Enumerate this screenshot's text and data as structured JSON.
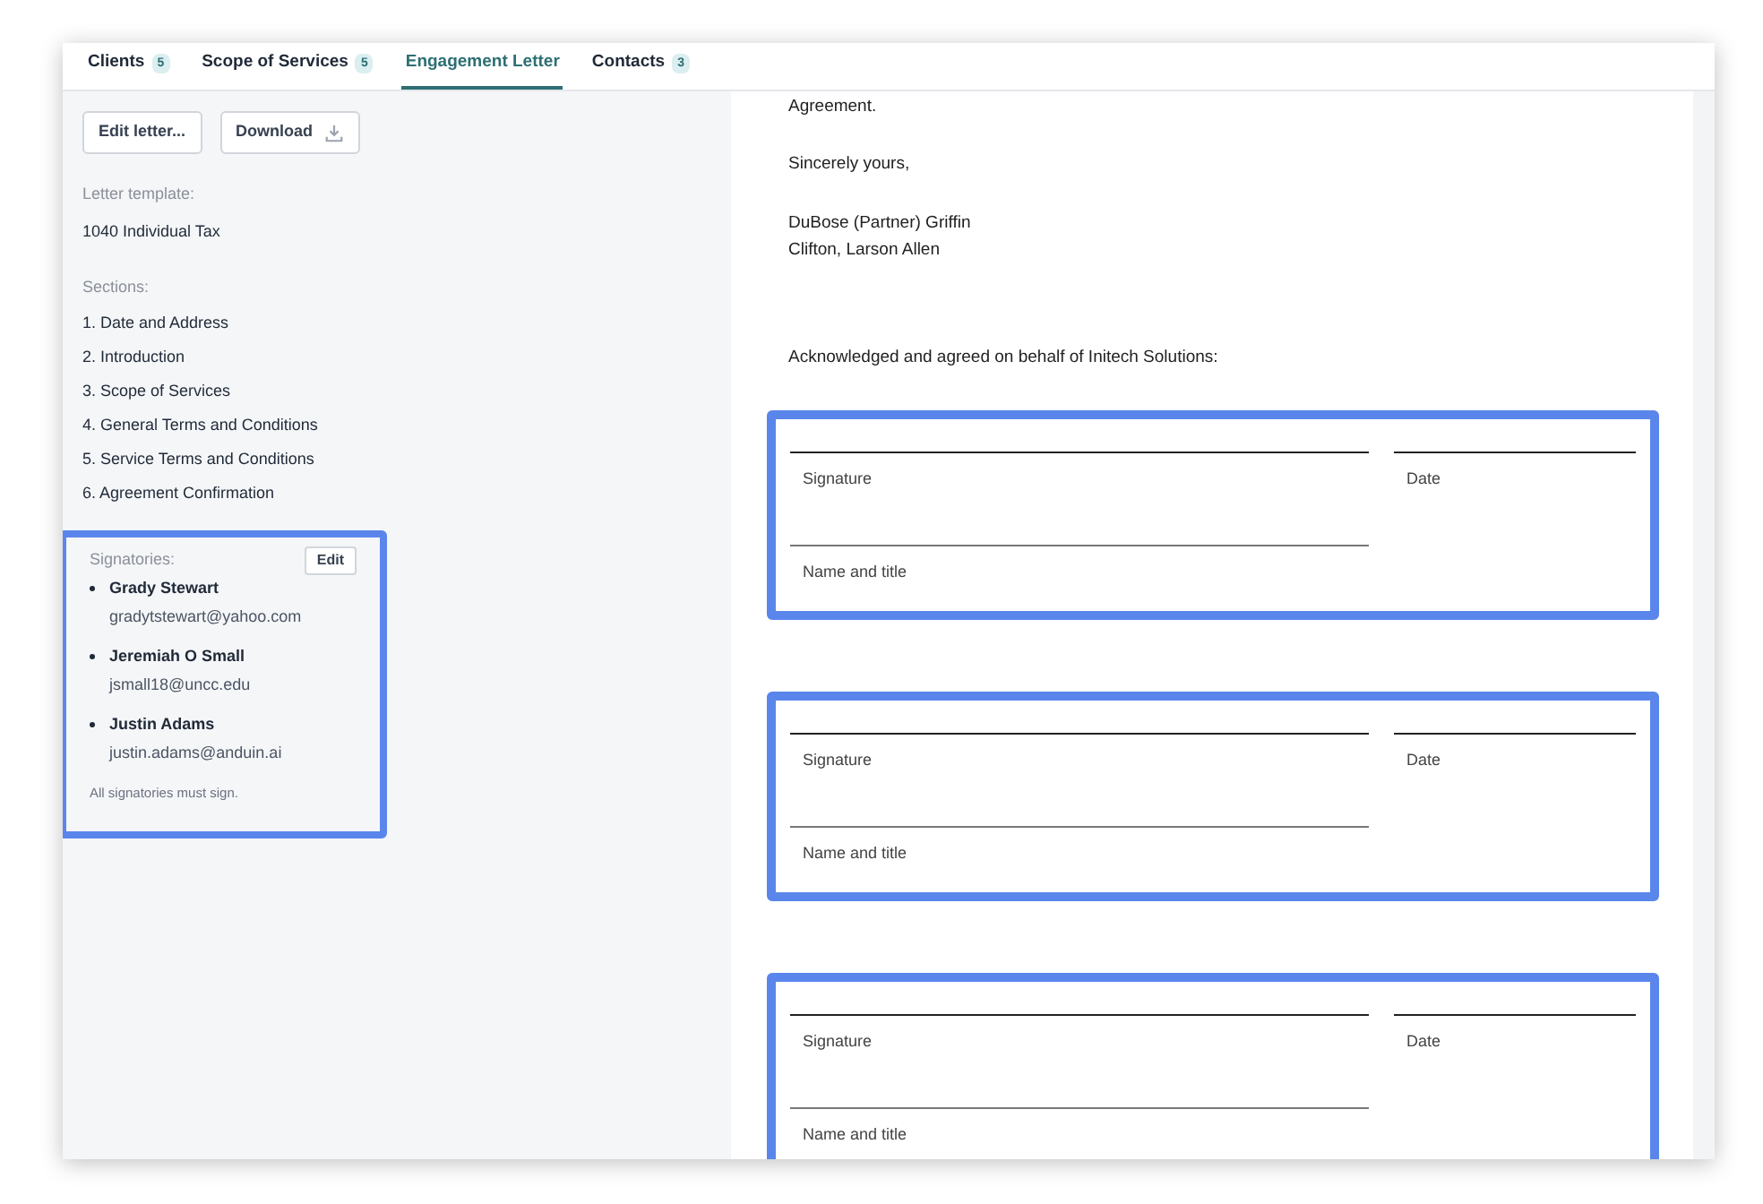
{
  "tabs": [
    {
      "label": "Clients",
      "count": "5",
      "selected": false
    },
    {
      "label": "Scope of Services",
      "count": "5",
      "selected": false
    },
    {
      "label": "Engagement Letter",
      "selected": true
    },
    {
      "label": "Contacts",
      "count": "3",
      "selected": false
    }
  ],
  "actions": [
    {
      "label": "Edit letter...",
      "kind": "plain"
    },
    {
      "label": "Download",
      "kind": "download"
    }
  ],
  "letter_template": {
    "label": "Letter template:",
    "value": "1040 Individual Tax"
  },
  "sections": {
    "label": "Sections:",
    "items": [
      "1. Date and Address",
      "2. Introduction",
      "3. Scope of Services",
      "4. General Terms and Conditions",
      "5. Service Terms and Conditions",
      "6. Agreement Confirmation"
    ]
  },
  "signatories": {
    "label": "Signatories:",
    "edit_button": "Edit",
    "highlighted": true,
    "people": [
      {
        "name": "Grady Stewart",
        "email": "gradytstewart@yahoo.com"
      },
      {
        "name": "Jeremiah O Small",
        "email": "jsmall18@uncc.edu"
      },
      {
        "name": "Justin Adams",
        "email": "justin.adams@anduin.ai"
      }
    ],
    "note": "All signatories must sign."
  },
  "document": {
    "lines": [
      "Agreement.",
      "Sincerely yours,"
    ],
    "signer": [
      "DuBose (Partner) Griffin",
      "Clifton, Larson Allen"
    ],
    "acknowledgement": "Acknowledged and agreed on behalf of Initech Solutions:",
    "signature_blocks": [
      {
        "signature_label": "Signature",
        "date_label": "Date",
        "name_label": "Name and title",
        "highlighted": true
      },
      {
        "signature_label": "Signature",
        "date_label": "Date",
        "name_label": "Name and title",
        "highlighted": true
      },
      {
        "signature_label": "Signature",
        "date_label": "Date",
        "name_label": "Name and title",
        "highlighted": true
      }
    ]
  }
}
